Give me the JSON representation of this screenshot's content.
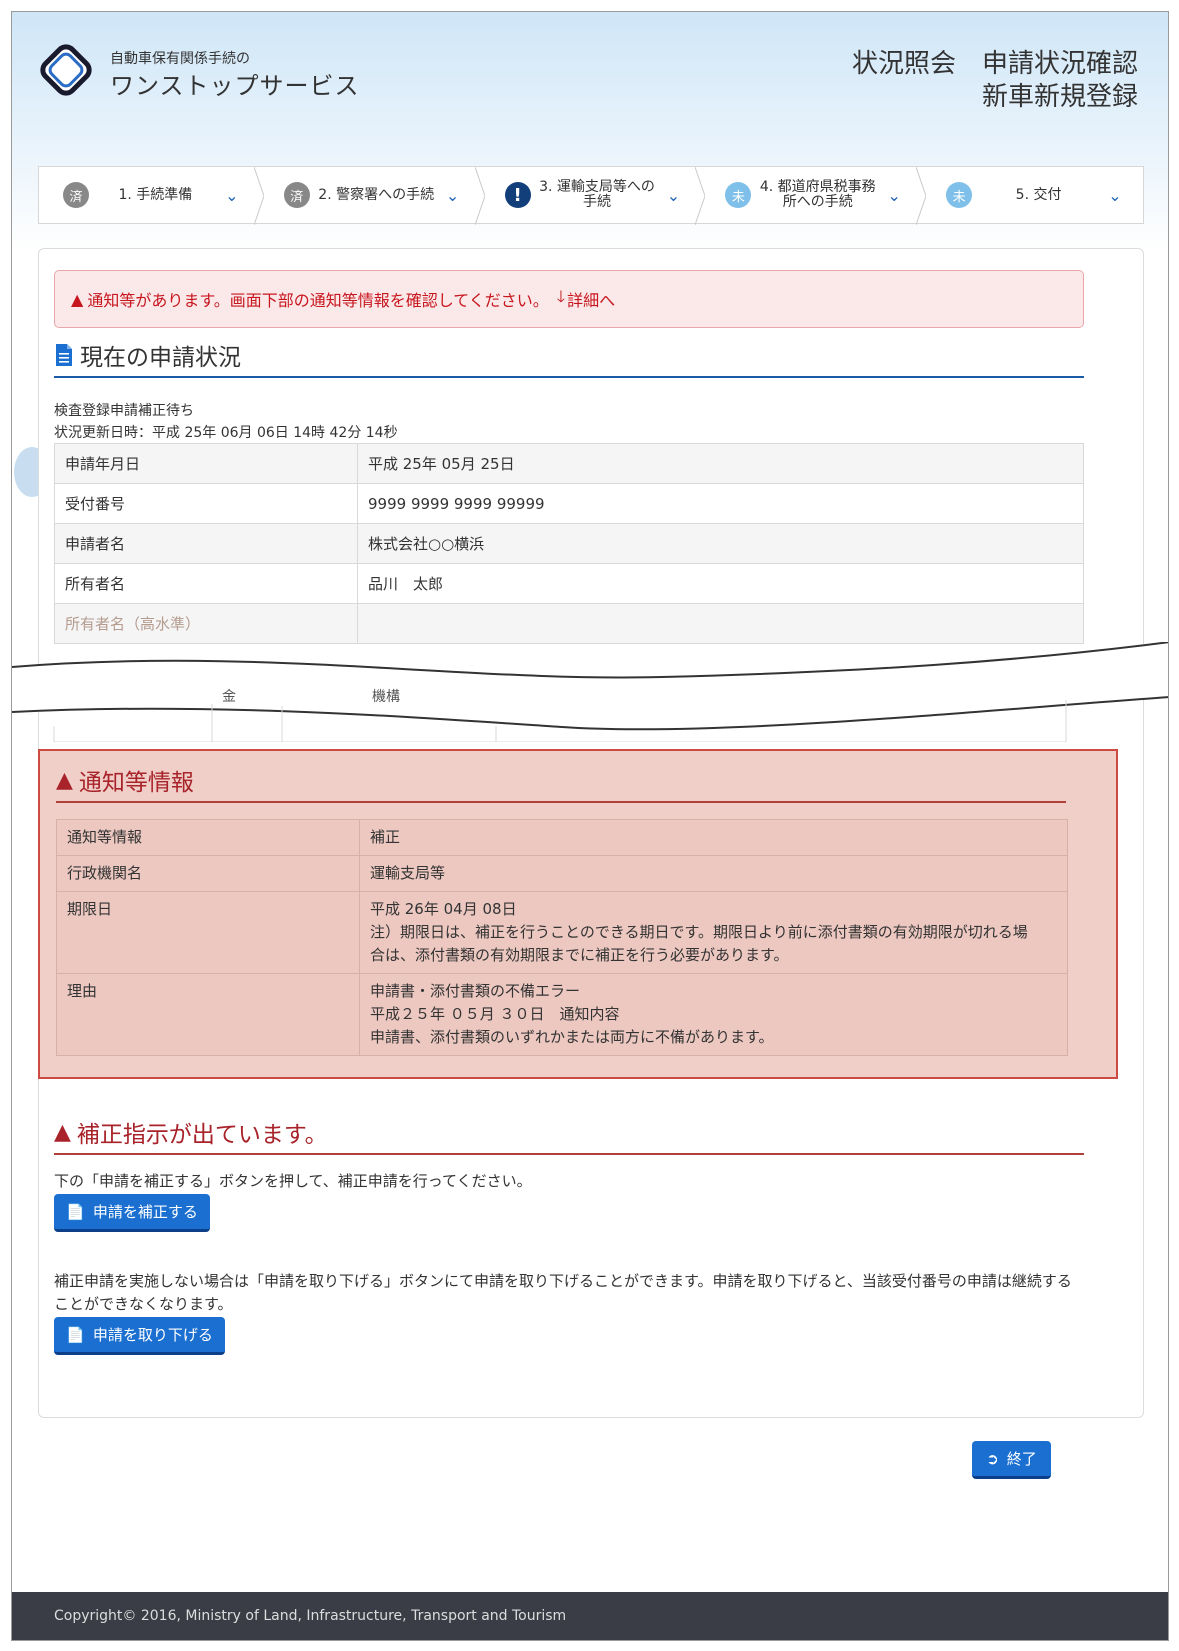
{
  "header": {
    "logo_small": "自動車保有関係手続の",
    "logo_big": "ワンストップサービス",
    "title_line1_a": "状況照会",
    "title_line1_b": "申請状況確認",
    "title_line2": "新車新規登録"
  },
  "steps": [
    {
      "badge": "済",
      "label": "1. 手続準備",
      "state": "done"
    },
    {
      "badge": "済",
      "label": "2. 警察署への手続",
      "state": "done"
    },
    {
      "badge": "!",
      "label": "3. 運輸支局等への手続",
      "state": "alert"
    },
    {
      "badge": "未",
      "label": "4. 都道府県税事務所への手続",
      "state": "todo"
    },
    {
      "badge": "未",
      "label": "5. 交付",
      "state": "todo"
    }
  ],
  "alert": {
    "text": "通知等があります。画面下部の通知等情報を確認してください。",
    "link": "詳細へ"
  },
  "status": {
    "title": "現在の申請状況",
    "state": "検査登録申請補正待ち",
    "updated": "状況更新日時：平成 25年 06月 06日 14時 42分 14秒",
    "rows": [
      {
        "key": "申請年月日",
        "value": "平成 25年 05月 25日"
      },
      {
        "key": "受付番号",
        "value": "9999 9999 9999 99999"
      },
      {
        "key": "申請者名",
        "value": "株式会社○○横浜"
      },
      {
        "key": "所有者名",
        "value": "品川　太郎"
      },
      {
        "key": "所有者名（高水準）",
        "value": ""
      }
    ],
    "cut_a": "金",
    "cut_b": "機構"
  },
  "notice": {
    "title": "通知等情報",
    "rows": [
      {
        "key": "通知等情報",
        "lines": [
          "補正"
        ]
      },
      {
        "key": "行政機関名",
        "lines": [
          "運輸支局等"
        ]
      },
      {
        "key": "期限日",
        "lines": [
          "平成 26年 04月 08日",
          "注）期限日は、補正を行うことのできる期日です。期限日より前に添付書類の有効期限が切れる場",
          "合は、添付書類の有効期限までに補正を行う必要があります。"
        ]
      },
      {
        "key": "理由",
        "lines": [
          "申請書・添付書類の不備エラー",
          "平成２５年 ０５月 ３０日　通知内容",
          "申請書、添付書類のいずれかまたは両方に不備があります。"
        ]
      }
    ]
  },
  "correction": {
    "title": "補正指示が出ています。",
    "text1": "下の「申請を補正する」ボタンを押して、補正申請を行ってください。",
    "btn1": "申請を補正する",
    "text2": "補正申請を実施しない場合は「申請を取り下げる」ボタンにて申請を取り下げることができます。申請を取り下げると、当該受付番号の申請は継続することができなくなります。",
    "btn2": "申請を取り下げる"
  },
  "end_button": "終了",
  "footer": "Copyright© 2016, Ministry of Land, Infrastructure, Transport and Tourism"
}
